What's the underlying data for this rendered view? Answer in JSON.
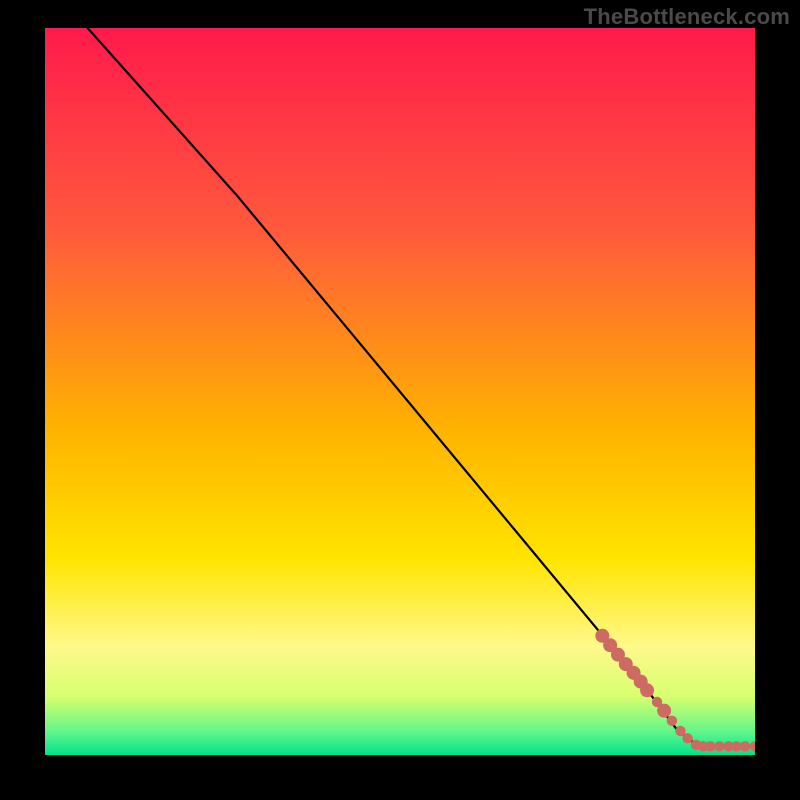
{
  "watermark": "TheBottleneck.com",
  "chart_data": {
    "type": "line",
    "title": "",
    "xlabel": "",
    "ylabel": "",
    "xlim": [
      0,
      100
    ],
    "ylim": [
      0,
      100
    ],
    "gradient_stops": [
      {
        "offset": 0.0,
        "color": "#ff1a4b"
      },
      {
        "offset": 0.28,
        "color": "#ff5a3c"
      },
      {
        "offset": 0.55,
        "color": "#ffb200"
      },
      {
        "offset": 0.73,
        "color": "#ffe400"
      },
      {
        "offset": 0.85,
        "color": "#fff98a"
      },
      {
        "offset": 0.92,
        "color": "#d6ff70"
      },
      {
        "offset": 0.97,
        "color": "#5cf58a"
      },
      {
        "offset": 1.0,
        "color": "#00e38a"
      }
    ],
    "curve": [
      {
        "x": 6,
        "y": 100
      },
      {
        "x": 27,
        "y": 77
      },
      {
        "x": 84,
        "y": 10
      },
      {
        "x": 89,
        "y": 3.5
      },
      {
        "x": 92,
        "y": 1.2
      },
      {
        "x": 100,
        "y": 1.2
      }
    ],
    "marker_color": "#cd6a62",
    "marker_radius_small": 5.2,
    "marker_radius_large": 7.0,
    "markers": [
      {
        "x": 78.5,
        "y": 16.4,
        "size": "large"
      },
      {
        "x": 79.6,
        "y": 15.1,
        "size": "large"
      },
      {
        "x": 80.7,
        "y": 13.8,
        "size": "large"
      },
      {
        "x": 81.8,
        "y": 12.5,
        "size": "large"
      },
      {
        "x": 82.9,
        "y": 11.3,
        "size": "large"
      },
      {
        "x": 83.9,
        "y": 10.1,
        "size": "large"
      },
      {
        "x": 84.8,
        "y": 8.9,
        "size": "large"
      },
      {
        "x": 86.2,
        "y": 7.3,
        "size": "small"
      },
      {
        "x": 87.2,
        "y": 6.1,
        "size": "large"
      },
      {
        "x": 88.3,
        "y": 4.7,
        "size": "small"
      },
      {
        "x": 89.5,
        "y": 3.3,
        "size": "small"
      },
      {
        "x": 90.5,
        "y": 2.3,
        "size": "small"
      },
      {
        "x": 91.7,
        "y": 1.4,
        "size": "small"
      },
      {
        "x": 92.7,
        "y": 1.2,
        "size": "small"
      },
      {
        "x": 93.7,
        "y": 1.2,
        "size": "small"
      },
      {
        "x": 95.0,
        "y": 1.2,
        "size": "small"
      },
      {
        "x": 96.3,
        "y": 1.2,
        "size": "small"
      },
      {
        "x": 97.4,
        "y": 1.2,
        "size": "small"
      },
      {
        "x": 98.6,
        "y": 1.2,
        "size": "small"
      },
      {
        "x": 100.0,
        "y": 1.2,
        "size": "small"
      }
    ]
  }
}
